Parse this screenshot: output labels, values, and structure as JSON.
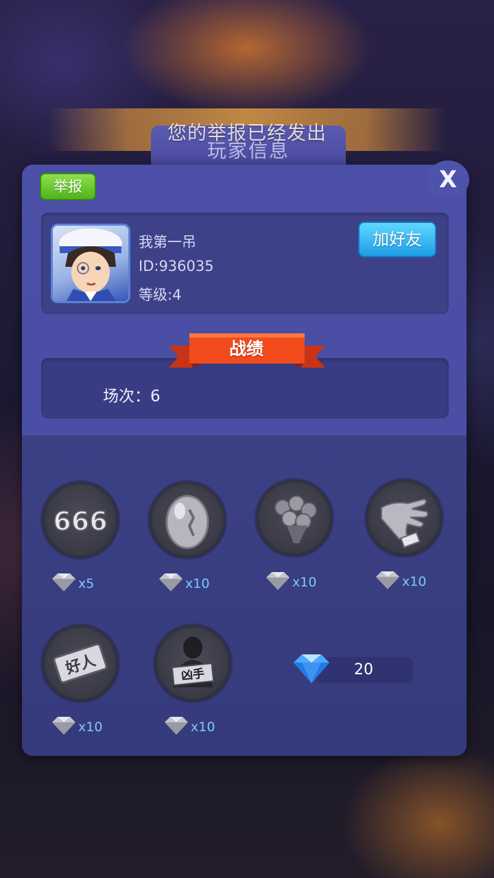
{
  "toast": {
    "message": "您的举报已经发出"
  },
  "panel": {
    "title": "玩家信息",
    "close_label": "X"
  },
  "report_button": {
    "label": "举报"
  },
  "player": {
    "name": "我第一吊",
    "id": "ID:936035",
    "level": "等级:4"
  },
  "add_friend_button": {
    "label": "加好友"
  },
  "stats": {
    "ribbon_title": "战绩",
    "matches": "场次：6"
  },
  "gifts": [
    {
      "icon": "666-badge-icon",
      "quantity": "x5"
    },
    {
      "icon": "egg-icon",
      "quantity": "x10"
    },
    {
      "icon": "rose-bouquet-icon",
      "quantity": "x10"
    },
    {
      "icon": "hand-icon",
      "quantity": "x10"
    },
    {
      "icon": "good-person-sign-icon",
      "quantity": "x10"
    },
    {
      "icon": "murderer-sign-icon",
      "quantity": "x10"
    }
  ],
  "gift_labels": {
    "sign_666": "666",
    "sign_good": "好人",
    "sign_murderer": "凶手"
  },
  "balance": {
    "icon": "diamond-icon",
    "value": "20"
  },
  "colors": {
    "panel": "#4b4fa6",
    "report_green": "#4fb41e",
    "friend_blue": "#1f9ee8",
    "ribbon_red": "#f04818",
    "price_text": "#7ec8ff"
  }
}
